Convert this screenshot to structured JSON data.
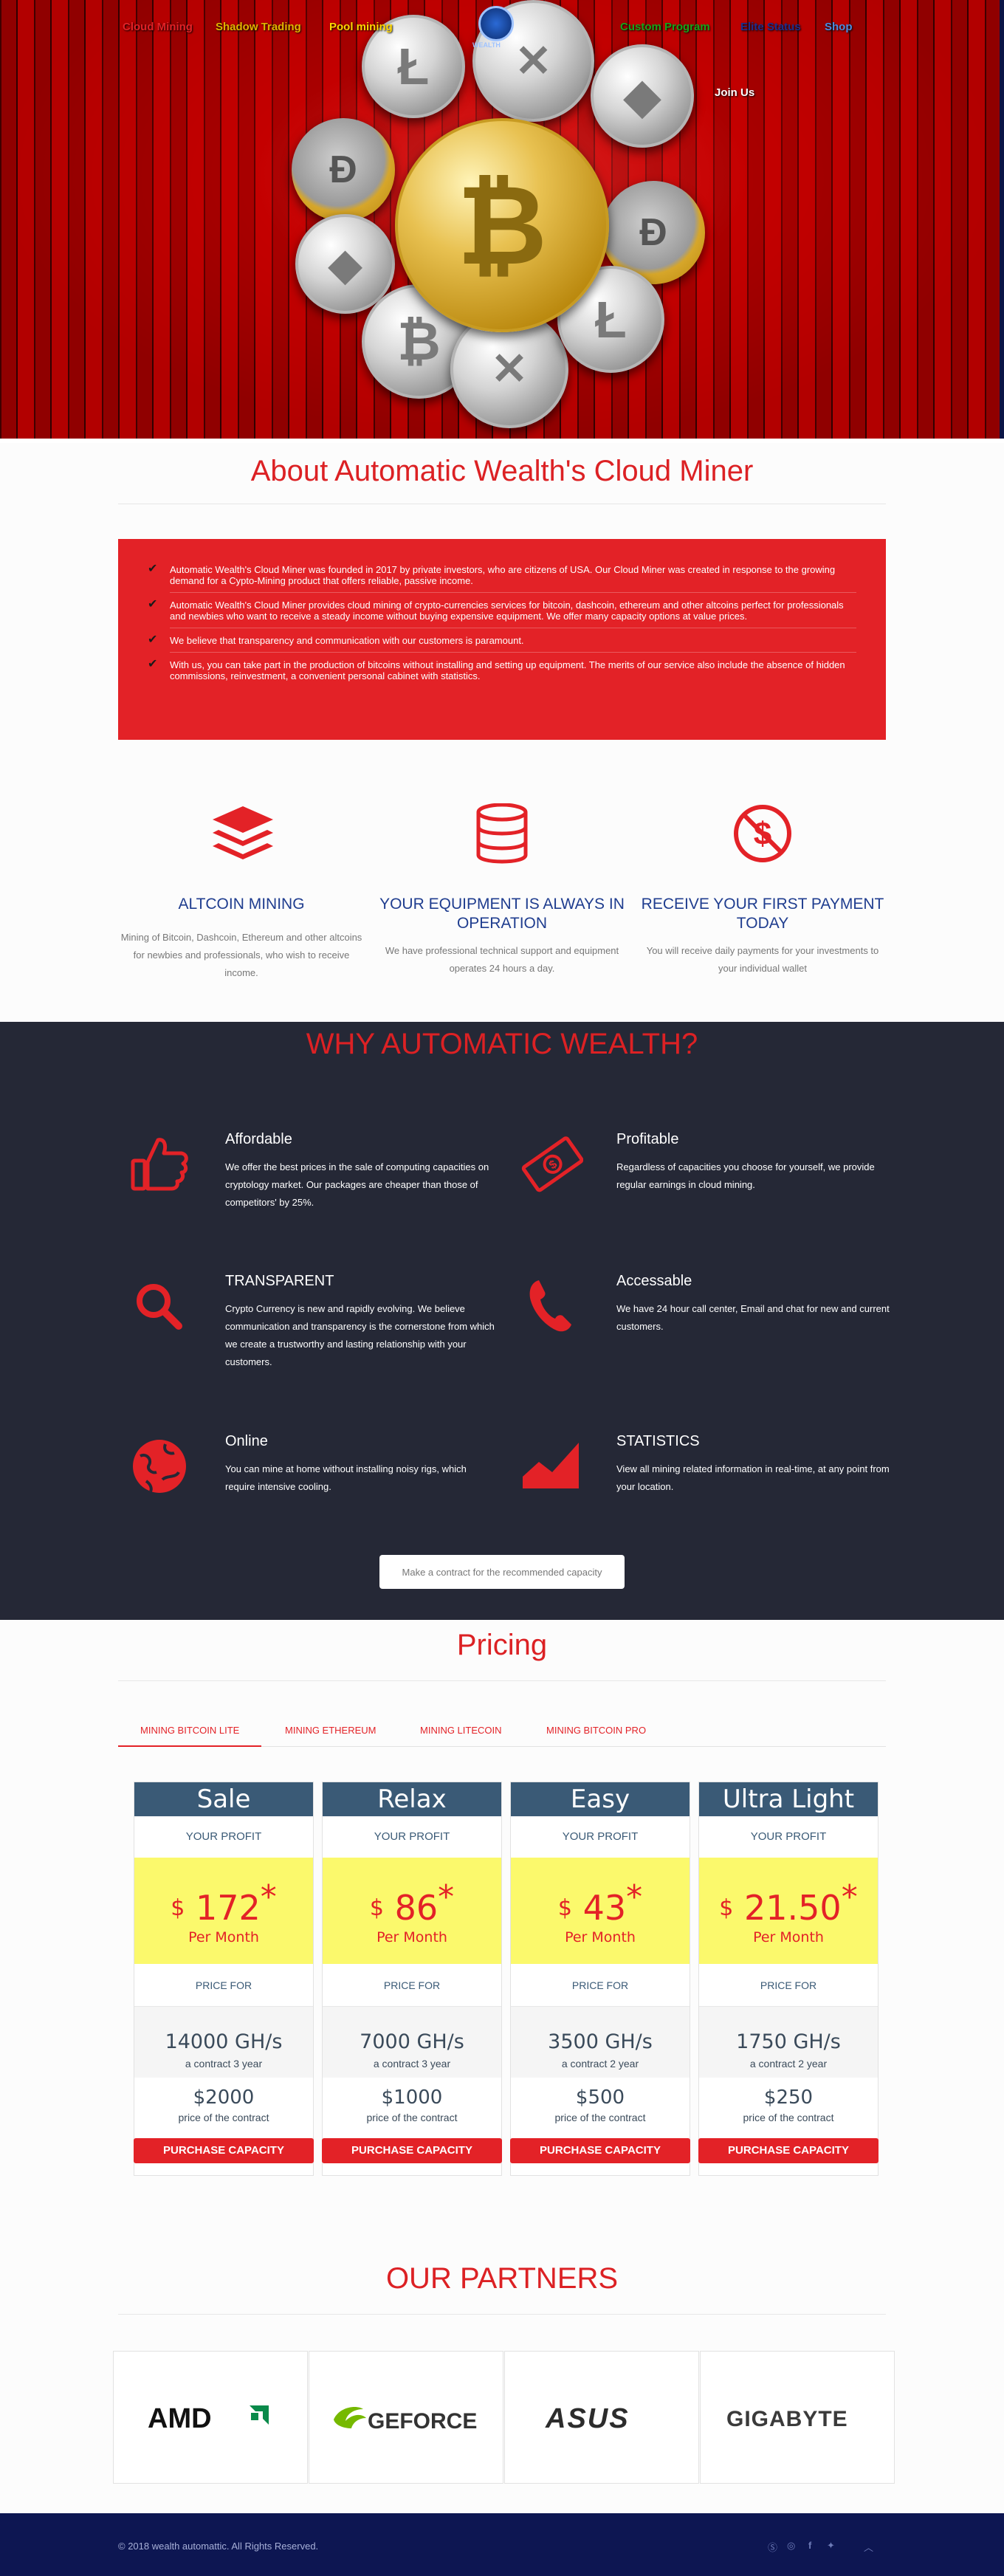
{
  "nav": {
    "items": [
      {
        "label": "Cloud Mining",
        "color": "#e32227"
      },
      {
        "label": "Shadow Trading",
        "color": "#e0b400"
      },
      {
        "label": "Pool mining",
        "color": "#ffd700"
      },
      {
        "label": "Custom Program",
        "color": "#16a51a"
      },
      {
        "label": "Elite Status",
        "color": "#1c2f8e"
      },
      {
        "label": "Shop",
        "color": "#4a8ce0"
      }
    ],
    "logo_text": "WEALTH",
    "join_us": "Join Us"
  },
  "about": {
    "title": "About Automatic Wealth's Cloud Miner",
    "items": [
      "Automatic Wealth's Cloud Miner was founded in 2017 by private investors, who are citizens of USA. Our Cloud Miner was created in response to the growing demand for a Cypto-Mining product that offers reliable, passive income.",
      "Automatic Wealth's Cloud Miner provides cloud mining of crypto-currencies services for bitcoin, dashcoin, ethereum and other altcoins perfect for professionals and newbies who want to receive a steady income without buying expensive equipment. We offer many capacity options at value prices.",
      "We believe that transparency and communication with our customers is paramount.",
      "With us, you can take part in the production of bitcoins without installing and setting up equipment. The merits of our service also include the absence of hidden commissions, reinvestment, a convenient personal cabinet with statistics."
    ]
  },
  "features": [
    {
      "title": "ALTCOIN MINING",
      "text": "Mining of Bitcoin, Dashcoin, Ethereum and other altcoins for newbies and professionals, who wish to receive income.",
      "icon": "layers-icon"
    },
    {
      "title": "YOUR EQUIPMENT IS ALWAYS IN OPERATION",
      "text": "We have professional technical support and equipment operates 24 hours a day.",
      "icon": "database-icon"
    },
    {
      "title": "RECEIVE YOUR FIRST PAYMENT TODAY",
      "text": "You will receive daily payments for your investments to your individual wallet",
      "icon": "no-fee-dollar-icon"
    }
  ],
  "why": {
    "title": "WHY AUTOMATIC WEALTH?",
    "items": [
      {
        "title": "Affordable",
        "text": "We offer the best prices in the sale of computing capacities on cryptology market. Our packages are cheaper than those of competitors' by 25%.",
        "icon": "thumbs-up-icon"
      },
      {
        "title": "Profitable",
        "text": "Regardless of capacities you choose for yourself, we provide regular earnings in cloud mining.",
        "icon": "money-bill-icon"
      },
      {
        "title": "TRANSPARENT",
        "text": "Crypto Currency is new and rapidly evolving. We believe communication and transparency is the cornerstone from which we create a trustworthy and lasting relationship with your customers.",
        "icon": "search-icon"
      },
      {
        "title": "Accessable",
        "text": "We have 24 hour call center, Email and chat for new and current customers.",
        "icon": "phone-icon"
      },
      {
        "title": "Online",
        "text": "You can mine at home without installing noisy rigs, which require intensive cooling.",
        "icon": "globe-icon"
      },
      {
        "title": "STATISTICS",
        "text": "View all mining related information in real-time, at any point from your location.",
        "icon": "area-chart-icon"
      }
    ],
    "button": "Make a contract for the recommended capacity"
  },
  "pricing": {
    "title": "Pricing",
    "tabs": [
      "MINING BITCOIN LITE",
      "MINING ETHEREUM",
      "MINING LITECOIN",
      "MINING BITCOIN PRO"
    ],
    "active_tab": 0,
    "plans": [
      {
        "name": "Sale",
        "profit_label": "YOUR PROFIT",
        "currency": "$",
        "profit": "172",
        "star": "*",
        "per": "Per Month",
        "price_for": "PRICE FOR",
        "hashrate": "14000 GH/s",
        "contract": "a contract 3 year",
        "cost": "$2000",
        "cost_label": "price of the contract",
        "button": "PURCHASE CAPACITY"
      },
      {
        "name": "Relax",
        "profit_label": "YOUR PROFIT",
        "currency": "$",
        "profit": "86",
        "star": "*",
        "per": "Per Month",
        "price_for": "PRICE FOR",
        "hashrate": "7000 GH/s",
        "contract": "a contract 3 year",
        "cost": "$1000",
        "cost_label": "price of the contract",
        "button": "PURCHASE CAPACITY"
      },
      {
        "name": "Easy",
        "profit_label": "YOUR PROFIT",
        "currency": "$",
        "profit": "43",
        "star": "*",
        "per": "Per Month",
        "price_for": "PRICE FOR",
        "hashrate": "3500 GH/s",
        "contract": "a contract 2 year",
        "cost": "$500",
        "cost_label": "price of the contract",
        "button": "PURCHASE CAPACITY"
      },
      {
        "name": "Ultra Light",
        "profit_label": "YOUR PROFIT",
        "currency": "$",
        "profit": "21.50",
        "star": "*",
        "per": "Per Month",
        "price_for": "PRICE FOR",
        "hashrate": "1750 GH/s",
        "contract": "a contract 2 year",
        "cost": "$250",
        "cost_label": "price of the contract",
        "button": "PURCHASE CAPACITY"
      }
    ]
  },
  "partners": {
    "title": "OUR PARTNERS",
    "logos": [
      "AMD",
      "GEFORCE",
      "ASUS",
      "GIGABYTE"
    ]
  },
  "footer": {
    "copyright": "© 2018 wealth automattic. All Rights Reserved.",
    "social": [
      "skype-icon",
      "whatsapp-icon",
      "facebook-icon",
      "twitter-icon",
      "back-to-top-icon"
    ]
  },
  "colors": {
    "accent_red": "#e32227",
    "dark_bg": "#252836",
    "footer_bg": "#0d1652",
    "plan_head": "#3a5a76",
    "price_yellow": "#fbf96c",
    "feature_blue": "#1f3d8f"
  }
}
